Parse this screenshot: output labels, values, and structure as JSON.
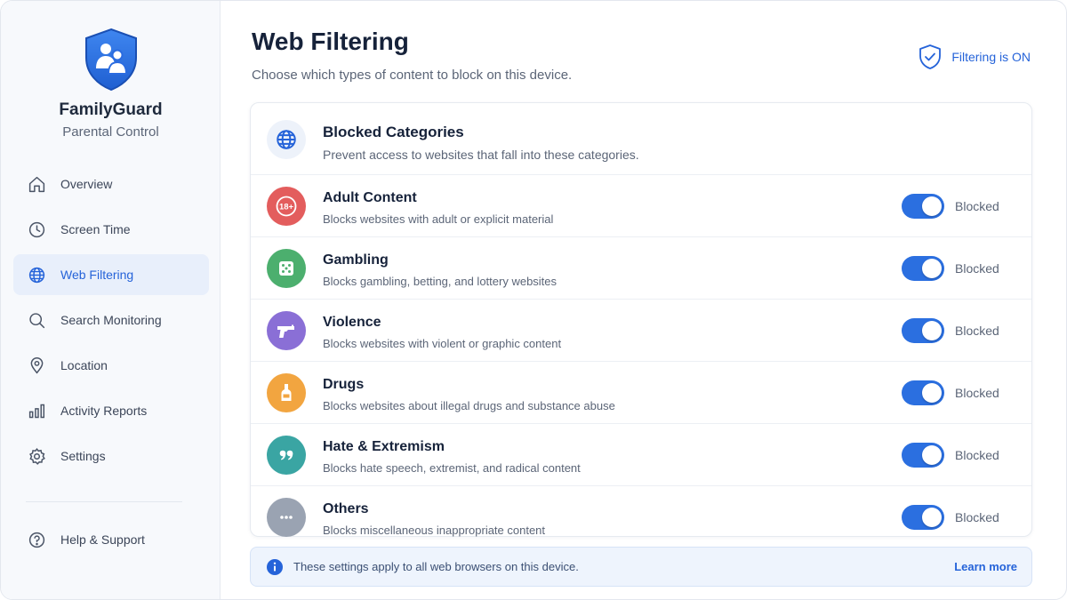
{
  "sidebar": {
    "app_name": "FamilyGuard",
    "app_subtitle": "Parental Control",
    "logo_icon": "shield-family-icon",
    "items": [
      {
        "label": "Overview",
        "icon": "home-icon",
        "active": false
      },
      {
        "label": "Screen Time",
        "icon": "clock-icon",
        "active": false
      },
      {
        "label": "Web Filtering",
        "icon": "globe-icon",
        "active": true
      },
      {
        "label": "Search Monitoring",
        "icon": "search-icon",
        "active": false
      },
      {
        "label": "Location",
        "icon": "map-pin-icon",
        "active": false
      },
      {
        "label": "Activity Reports",
        "icon": "bar-chart-icon",
        "active": false
      },
      {
        "label": "Settings",
        "icon": "gear-icon",
        "active": false
      }
    ],
    "help": {
      "label": "Help & Support",
      "icon": "question-icon"
    }
  },
  "header": {
    "title": "Web Filtering",
    "subtitle": "Choose which types of content to block on this device.",
    "status_label": "Filtering is ON",
    "status_icon": "shield-check-icon"
  },
  "card": {
    "title": "Blocked Categories",
    "subtitle": "Prevent access to websites that fall into these categories.",
    "icon": "globe-icon",
    "categories": [
      {
        "title": "Adult Content",
        "description": "Blocks websites with adult or explicit material",
        "icon": "adult-18-icon",
        "color": "#e35d5d",
        "state": "Blocked",
        "enabled": true
      },
      {
        "title": "Gambling",
        "description": "Blocks gambling, betting, and lottery websites",
        "icon": "dice-icon",
        "color": "#4caf6e",
        "state": "Blocked",
        "enabled": true
      },
      {
        "title": "Violence",
        "description": "Blocks websites with violent or graphic content",
        "icon": "gun-icon",
        "color": "#8a6fd6",
        "state": "Blocked",
        "enabled": true
      },
      {
        "title": "Drugs",
        "description": "Blocks websites about illegal drugs and substance abuse",
        "icon": "bottle-icon",
        "color": "#f2a540",
        "state": "Blocked",
        "enabled": true
      },
      {
        "title": "Hate & Extremism",
        "description": "Blocks hate speech, extremist, and radical content",
        "icon": "quote-icon",
        "color": "#3aa5a3",
        "state": "Blocked",
        "enabled": true
      },
      {
        "title": "Others",
        "description": "Blocks miscellaneous inappropriate content",
        "icon": "more-icon",
        "color": "#9aa3b2",
        "state": "Blocked",
        "enabled": true
      }
    ]
  },
  "info": {
    "text": "These settings apply to all web browsers on this device.",
    "link": "Learn more",
    "icon": "info-icon"
  },
  "colors": {
    "accent": "#2563d9",
    "toggle_on": "#2b6fe0"
  }
}
